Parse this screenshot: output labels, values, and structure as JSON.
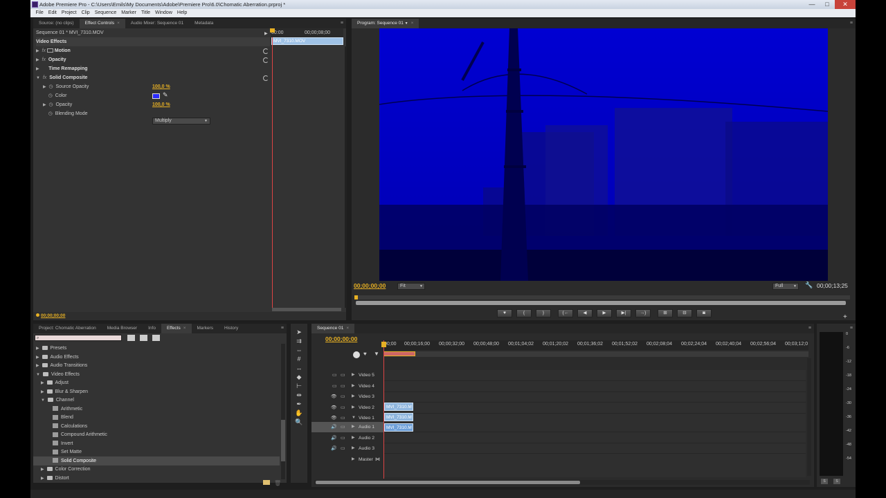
{
  "window": {
    "title": "Adobe Premiere Pro - C:\\Users\\Emils\\My Documents\\Adobe\\Premiere Pro\\6.0\\Chomatic Aberration.prproj *",
    "controls": [
      "—",
      "□",
      "✕"
    ]
  },
  "menu": [
    "File",
    "Edit",
    "Project",
    "Clip",
    "Sequence",
    "Marker",
    "Title",
    "Window",
    "Help"
  ],
  "top_left_tabs": [
    "Source: (no clips)",
    "Effect Controls",
    "Audio Mixer: Sequence 01",
    "Metadata"
  ],
  "effect_controls": {
    "header": "Sequence 01 * MVI_7310.MOV",
    "section": "Video Effects",
    "timecodes": [
      "00:00",
      "00;00;08;00"
    ],
    "clip_label": "MVI_7310.MOV",
    "effects": [
      {
        "name": "Motion",
        "bold": true
      },
      {
        "name": "Opacity",
        "bold": true
      },
      {
        "name": "Time Remapping",
        "bold": true
      },
      {
        "name": "Solid Composite",
        "bold": true
      }
    ],
    "props": [
      {
        "name": "Source Opacity",
        "value": "100,0 %"
      },
      {
        "name": "Color",
        "value": ""
      },
      {
        "name": "Opacity",
        "value": "100,0 %"
      },
      {
        "name": "Blending Mode",
        "value": "Multiply"
      }
    ],
    "bottom_timecode": "00;00;00;00",
    "color_swatch": "#2b2bff"
  },
  "program": {
    "tab": "Program: Sequence 01",
    "timecode_left": "00;00;00;00",
    "fit": "Fit",
    "quality": "Full",
    "timecode_right": "00;00;13;25"
  },
  "bottom_left_tabs": [
    "Project: Chomatic Aberration",
    "Media Browser",
    "Info",
    "Effects",
    "Markers",
    "History"
  ],
  "effects_tree": [
    {
      "label": "Presets",
      "indent": 0,
      "type": "folder"
    },
    {
      "label": "Audio Effects",
      "indent": 0,
      "type": "folder"
    },
    {
      "label": "Audio Transitions",
      "indent": 0,
      "type": "folder"
    },
    {
      "label": "Video Effects",
      "indent": 0,
      "type": "folder",
      "open": true
    },
    {
      "label": "Adjust",
      "indent": 1,
      "type": "folder"
    },
    {
      "label": "Blur & Sharpen",
      "indent": 1,
      "type": "folder"
    },
    {
      "label": "Channel",
      "indent": 1,
      "type": "folder",
      "open": true
    },
    {
      "label": "Arithmetic",
      "indent": 2,
      "type": "fx"
    },
    {
      "label": "Blend",
      "indent": 2,
      "type": "fx"
    },
    {
      "label": "Calculations",
      "indent": 2,
      "type": "fx"
    },
    {
      "label": "Compound Arithmetic",
      "indent": 2,
      "type": "fx"
    },
    {
      "label": "Invert",
      "indent": 2,
      "type": "fx"
    },
    {
      "label": "Set Matte",
      "indent": 2,
      "type": "fx"
    },
    {
      "label": "Solid Composite",
      "indent": 2,
      "type": "fx",
      "selected": true
    },
    {
      "label": "Color Correction",
      "indent": 1,
      "type": "folder"
    },
    {
      "label": "Distort",
      "indent": 1,
      "type": "folder"
    }
  ],
  "timeline": {
    "tab": "Sequence 01",
    "timecode": "00;00;00;00",
    "ruler": [
      "00;00",
      "00;00;16;00",
      "00;00;32;00",
      "00;00;48;00",
      "00;01;04;02",
      "00;01;20;02",
      "00;01;36;02",
      "00;01;52;02",
      "00;02;08;04",
      "00;02;24;04",
      "00;02;40;04",
      "00;02;56;04",
      "00;03;12;0"
    ],
    "tracks": [
      "Video 5",
      "Video 4",
      "Video 3",
      "Video 2",
      "Video 1",
      "Audio 1",
      "Audio 2",
      "Audio 3",
      "Master"
    ],
    "clips": {
      "v2": "MVI_7310.M",
      "v1": "MVI_7310.M",
      "a1": "MVI_7310.M"
    }
  },
  "meter_scale": [
    "0",
    "-6",
    "-12",
    "-18",
    "-24",
    "-30",
    "-36",
    "-42",
    "-48",
    "-54"
  ],
  "meter_buttons": [
    "S",
    "S"
  ]
}
